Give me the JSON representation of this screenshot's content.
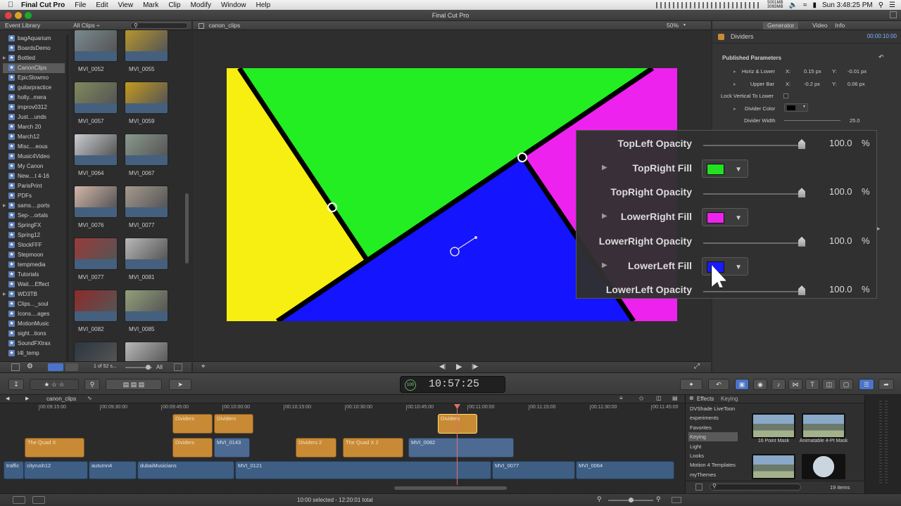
{
  "menubar": {
    "app_name": "Final Cut Pro",
    "items": [
      "File",
      "Edit",
      "View",
      "Mark",
      "Clip",
      "Modify",
      "Window",
      "Help"
    ],
    "clock": "Sun 3:48:25 PM",
    "mem1": "5001MB",
    "mem2": "3093MB"
  },
  "window": {
    "title": "Final Cut Pro"
  },
  "library": {
    "header_left": "Event Library",
    "header_mid": "All Clips ÷",
    "items": [
      {
        "label": "bagAquarium"
      },
      {
        "label": "BoardsDemo"
      },
      {
        "label": "Bottled"
      },
      {
        "label": "CanonClips",
        "selected": true
      },
      {
        "label": "EpicSlowmo"
      },
      {
        "label": "guitarpractice"
      },
      {
        "label": "holly...mera"
      },
      {
        "label": "improv0312"
      },
      {
        "label": "Just....unds"
      },
      {
        "label": "March 20"
      },
      {
        "label": "March12"
      },
      {
        "label": "Misc....eous"
      },
      {
        "label": "Music4Video"
      },
      {
        "label": "My Canon"
      },
      {
        "label": "New....t 4-16"
      },
      {
        "label": "ParisPrint"
      },
      {
        "label": "PDFs"
      },
      {
        "label": "sams....ports"
      },
      {
        "label": "Sep-...ortals"
      },
      {
        "label": "SpringFX"
      },
      {
        "label": "Spring12"
      },
      {
        "label": "StockFFF"
      },
      {
        "label": "Stepmoon"
      },
      {
        "label": "tempmedia"
      },
      {
        "label": "Tutorials"
      },
      {
        "label": "Wait....Effect"
      },
      {
        "label": "WD3TB"
      },
      {
        "label": "Clips..._soul"
      },
      {
        "label": "Icons....ages"
      },
      {
        "label": "MotionMusic"
      },
      {
        "label": "sight...tions"
      },
      {
        "label": "SoundFXtrax"
      },
      {
        "label": "t4l_temp"
      }
    ],
    "footer_count": "1 of 52 s...",
    "footer_all": "All"
  },
  "browser": {
    "thumbs": [
      {
        "label": "MVI_0052",
        "color": "#7a8a8e"
      },
      {
        "label": "MVI_0055",
        "color": "#b5962e"
      },
      {
        "label": "MVI_0057",
        "color": "#7f8a5b"
      },
      {
        "label": "MVI_0059",
        "color": "#c49a1f"
      },
      {
        "label": "MVI_0064",
        "color": "#c8ccd0"
      },
      {
        "label": "MVI_0067",
        "color": "#8a9a8c"
      },
      {
        "label": "MVI_0076",
        "color": "#d2b6a8"
      },
      {
        "label": "MVI_0077",
        "color": "#a59a8e"
      },
      {
        "label": "MVI_0077",
        "color": "#9a3a3a"
      },
      {
        "label": "MVI_0081",
        "color": "#b8b8b8"
      },
      {
        "label": "MVI_0082",
        "color": "#8e2a2a"
      },
      {
        "label": "MVI_0085",
        "color": "#93a07a"
      },
      {
        "label": "",
        "color": "#2c3540"
      },
      {
        "label": "",
        "color": "#b8b8b8"
      }
    ]
  },
  "viewer": {
    "header_clip": "canon_clips",
    "zoom": "50%"
  },
  "inspector": {
    "tabs": [
      "Generator",
      "Video",
      "Info"
    ],
    "title": "Dividers",
    "timecode": "00:00:10:00",
    "section": "Published Parameters",
    "rows": [
      {
        "label": "Horiz & Lower",
        "x_lbl": "X:",
        "x": "0.15 px",
        "y_lbl": "Y:",
        "y": "-0.01 px"
      },
      {
        "label": "Upper Bar",
        "x_lbl": "X:",
        "x": "-0.2 px",
        "y_lbl": "Y:",
        "y": "0.06 px"
      }
    ],
    "lock_label": "Lock Vertical To Lower",
    "divider_color": "Divider Color",
    "divider_width": "Divider Width",
    "divider_width_val": "25.0"
  },
  "hud": {
    "rows": [
      {
        "type": "slider",
        "label": "TopLeft Opacity",
        "value": "100.0",
        "unit": "%"
      },
      {
        "type": "fill",
        "label": "TopRight Fill",
        "color": "#22e022"
      },
      {
        "type": "slider",
        "label": "TopRight Opacity",
        "value": "100.0",
        "unit": "%"
      },
      {
        "type": "fill",
        "label": "LowerRight Fill",
        "color": "#ee22ee"
      },
      {
        "type": "slider",
        "label": "LowerRight Opacity",
        "value": "100.0",
        "unit": "%"
      },
      {
        "type": "fill",
        "label": "LowerLeft Fill",
        "color": "#1a1aff"
      },
      {
        "type": "slider",
        "label": "LowerLeft Opacity",
        "value": "100.0",
        "unit": "%"
      }
    ]
  },
  "toolbar": {
    "timecode": "10:57:25",
    "timecode_badge": "100"
  },
  "timeline": {
    "sequence": "canon_clips",
    "ruler": [
      "00:09:15:00",
      "00:09:30:00",
      "00:09:45:00",
      "00:10:00:00",
      "00:10:15:00",
      "00:10:30:00",
      "00:10:45:00",
      "00:11:00:00",
      "00:11:15:00",
      "00:11:30:00",
      "00:11:45:00"
    ],
    "clips": [
      {
        "label": "Dividers",
        "kind": "gen"
      },
      {
        "label": "Dividers",
        "kind": "gen"
      },
      {
        "label": "Dividers",
        "kind": "gen"
      },
      {
        "label": "The Quad X",
        "kind": "gen"
      },
      {
        "label": "Dividers",
        "kind": "gen"
      },
      {
        "label": "MVI_0143",
        "kind": "vid"
      },
      {
        "label": "Dividers 2",
        "kind": "gen"
      },
      {
        "label": "The Quad X 2",
        "kind": "gen"
      },
      {
        "label": "MVI_0082",
        "kind": "vid"
      },
      {
        "label": "traffic",
        "kind": "aud"
      },
      {
        "label": "cityrush12",
        "kind": "aud"
      },
      {
        "label": "autumn4",
        "kind": "aud"
      },
      {
        "label": "dubaiMusicians",
        "kind": "aud"
      },
      {
        "label": "MVI_0121",
        "kind": "aud"
      },
      {
        "label": "MVI_0077",
        "kind": "aud"
      },
      {
        "label": "MVI_0064",
        "kind": "aud"
      }
    ]
  },
  "effects": {
    "header": "Effects",
    "subheader": "Keying",
    "categories": [
      {
        "label": "DVShade LiveToon"
      },
      {
        "label": "experiments"
      },
      {
        "label": "Favorites"
      },
      {
        "label": "Keying",
        "selected": true
      },
      {
        "label": "Light"
      },
      {
        "label": "Looks"
      },
      {
        "label": "Motion 4 Templates"
      },
      {
        "label": "myThemes"
      }
    ],
    "items": [
      {
        "label": "16 Point Mask"
      },
      {
        "label": "Animatable 4-Pt Mask"
      },
      {
        "label": ""
      },
      {
        "label": ""
      }
    ],
    "count": "19 items"
  },
  "status": {
    "text": "10:00 selected - 12:20:01 total"
  }
}
